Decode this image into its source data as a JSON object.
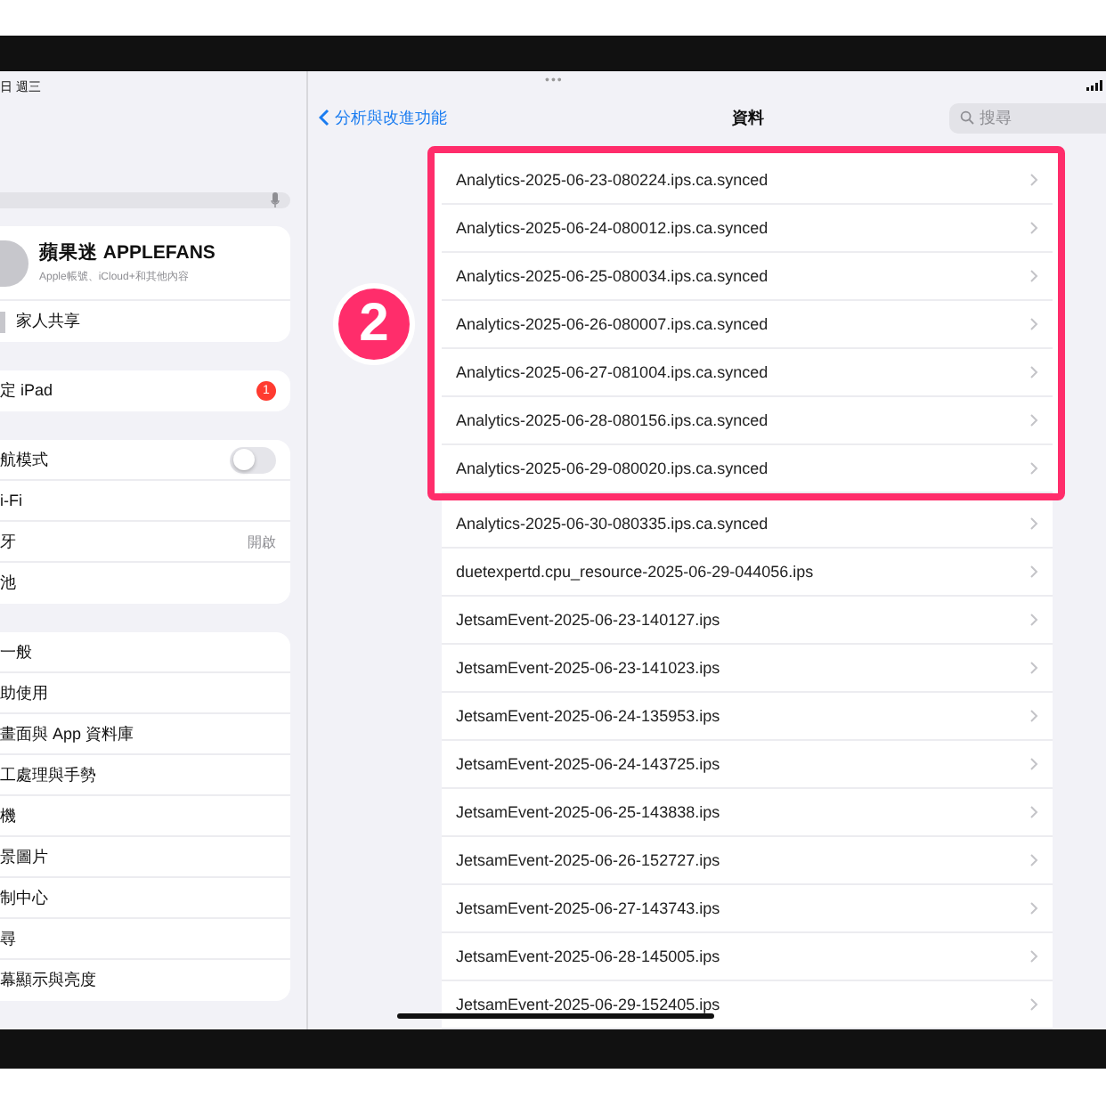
{
  "status_bar": {
    "date": "日 週三"
  },
  "sidebar": {
    "account": {
      "name": "蘋果迷 APPLEFANS",
      "subtitle": "Apple帳號、iCloud+和其他內容",
      "family": "家人共享"
    },
    "groups": [
      {
        "items": [
          {
            "label": "定 iPad",
            "kind": "badge",
            "badge": "1"
          }
        ]
      },
      {
        "items": [
          {
            "label": "航模式",
            "kind": "toggle",
            "on": false
          },
          {
            "label": "i-Fi",
            "kind": "plain"
          },
          {
            "label": "牙",
            "kind": "value",
            "value": "開啟"
          },
          {
            "label": "池",
            "kind": "plain"
          }
        ]
      },
      {
        "items": [
          {
            "label": "一般",
            "kind": "plain"
          },
          {
            "label": "助使用",
            "kind": "plain"
          },
          {
            "label": "畫面與 App 資料庫",
            "kind": "plain"
          },
          {
            "label": "工處理與手勢",
            "kind": "plain"
          },
          {
            "label": "機",
            "kind": "plain"
          },
          {
            "label": "景圖片",
            "kind": "plain"
          },
          {
            "label": "制中心",
            "kind": "plain"
          },
          {
            "label": "尋",
            "kind": "plain"
          },
          {
            "label": "幕顯示與亮度",
            "kind": "plain"
          }
        ]
      }
    ]
  },
  "detail": {
    "multitask_indicator": "•••",
    "back": "分析與改進功能",
    "title": "資料",
    "search": {
      "placeholder": "搜尋"
    },
    "annotation": {
      "number": "2"
    },
    "highlighted_files": [
      {
        "name": "Analytics-2025-06-23-080224.ips.ca.synced"
      },
      {
        "name": "Analytics-2025-06-24-080012.ips.ca.synced"
      },
      {
        "name": "Analytics-2025-06-25-080034.ips.ca.synced"
      },
      {
        "name": "Analytics-2025-06-26-080007.ips.ca.synced"
      },
      {
        "name": "Analytics-2025-06-27-081004.ips.ca.synced"
      },
      {
        "name": "Analytics-2025-06-28-080156.ips.ca.synced"
      },
      {
        "name": "Analytics-2025-06-29-080020.ips.ca.synced"
      }
    ],
    "files": [
      {
        "name": "Analytics-2025-06-30-080335.ips.ca.synced"
      },
      {
        "name": "duetexpertd.cpu_resource-2025-06-29-044056.ips"
      },
      {
        "name": "JetsamEvent-2025-06-23-140127.ips"
      },
      {
        "name": "JetsamEvent-2025-06-23-141023.ips"
      },
      {
        "name": "JetsamEvent-2025-06-24-135953.ips"
      },
      {
        "name": "JetsamEvent-2025-06-24-143725.ips"
      },
      {
        "name": "JetsamEvent-2025-06-25-143838.ips"
      },
      {
        "name": "JetsamEvent-2025-06-26-152727.ips"
      },
      {
        "name": "JetsamEvent-2025-06-27-143743.ips"
      },
      {
        "name": "JetsamEvent-2025-06-28-145005.ips"
      },
      {
        "name": "JetsamEvent-2025-06-29-152405.ips"
      }
    ]
  }
}
